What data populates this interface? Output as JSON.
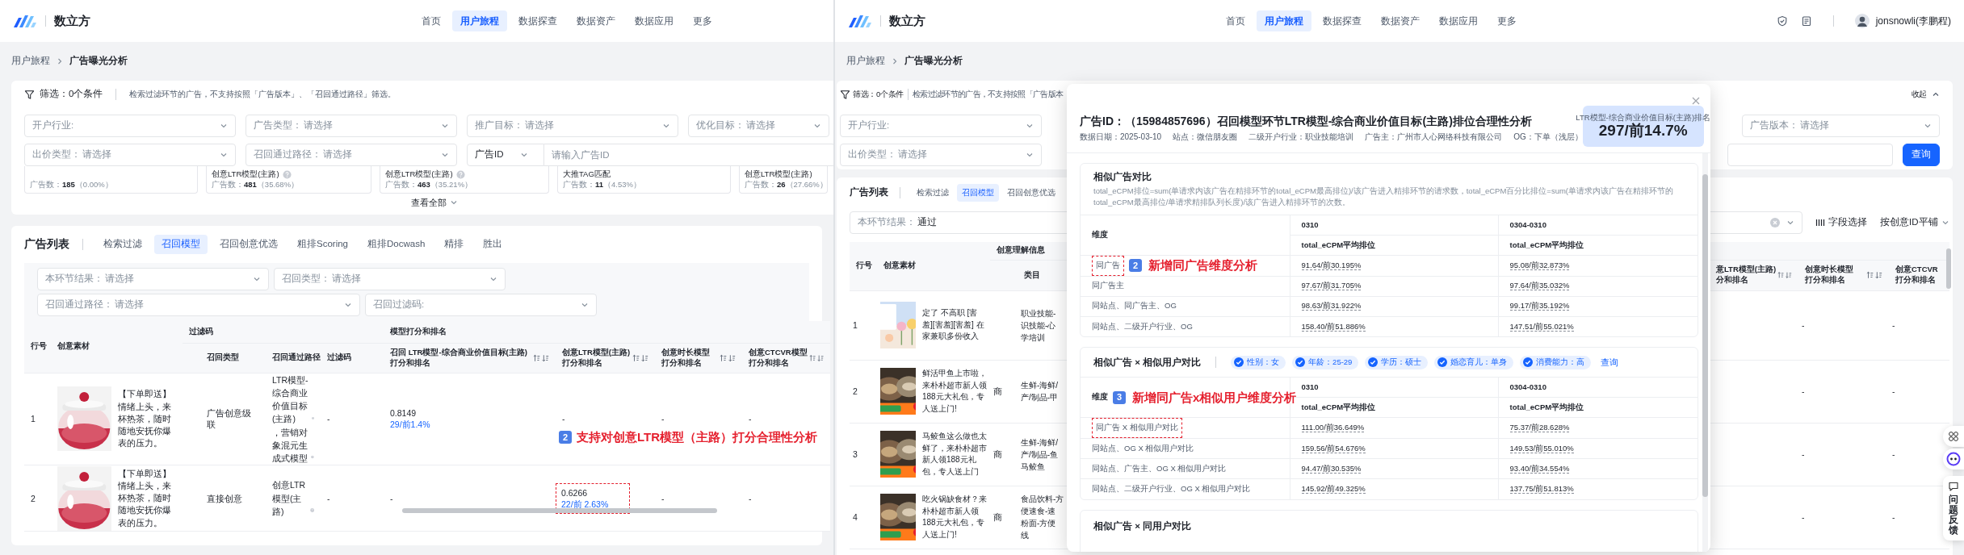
{
  "left_screen": {
    "header": {
      "brand": "数立方",
      "nav": [
        {
          "label": "首页",
          "selected": false
        },
        {
          "label": "用户旅程",
          "selected": true
        },
        {
          "label": "数据探查",
          "selected": false
        },
        {
          "label": "数据资产",
          "selected": false
        },
        {
          "label": "数据应用",
          "selected": false
        },
        {
          "label": "更多",
          "selected": false
        }
      ]
    },
    "breadcrumb": [
      "用户旅程",
      "广告曝光分析"
    ],
    "filter_panel": {
      "summary": "筛选：0个条件",
      "hint": "检索过滤环节的广告，不支持按照「广告版本」、「召回通过路径」筛选。",
      "rows": [
        [
          {
            "kind": "select",
            "label": "开户行业:"
          },
          {
            "kind": "select",
            "label": "广告类型：",
            "placeholder": "请选择"
          },
          {
            "kind": "select",
            "label": "推广目标：",
            "placeholder": "请选择"
          },
          {
            "kind": "select",
            "label": "优化目标：",
            "placeholder": "请选择"
          }
        ],
        [
          {
            "kind": "select",
            "label": "出价类型：",
            "placeholder": "请选择"
          },
          {
            "kind": "select",
            "label": "召回通过路径：",
            "placeholder": "请选择"
          },
          {
            "kind": "id",
            "label": "广告ID",
            "placeholder": "请输入广告ID"
          }
        ]
      ],
      "stats": [
        {
          "text": "广告数：**185**（0.00%）"
        },
        {
          "title": "创意LTR模型(主路)",
          "help": true,
          "text": "广告数：**481**（35.68%）"
        },
        {
          "title": "创意LTR模型(主路)",
          "help": true,
          "text": "广告数：**463**（35.21%）"
        },
        {
          "title": "大推TAG匹配",
          "help": false,
          "text": "广告数：**11**（4.53%）"
        },
        {
          "title": "创意LTR模型(主路)",
          "help": false,
          "text": "广告数：**26**（27.66%）"
        }
      ],
      "expand": "查看全部"
    },
    "list": {
      "title": "广告列表",
      "tabs": [
        {
          "label": "检索过滤",
          "selected": false
        },
        {
          "label": "召回模型",
          "selected": true
        },
        {
          "label": "召回创意优选",
          "selected": false
        },
        {
          "label": "粗排Scoring",
          "selected": false
        },
        {
          "label": "粗排Docwash",
          "selected": false
        },
        {
          "label": "精排",
          "selected": false
        },
        {
          "label": "胜出",
          "selected": false
        }
      ],
      "filters": [
        {
          "kind": "select",
          "label": "本环节结果：",
          "placeholder": "请选择"
        },
        {
          "kind": "select",
          "label": "召回类型：",
          "placeholder": "请选择"
        },
        {
          "kind": "select",
          "label": "召回通过路径：",
          "placeholder": "请选择"
        },
        {
          "kind": "select",
          "label": "召回过滤码:"
        }
      ],
      "table": {
        "header": [
          {
            "label": "行号"
          },
          {
            "label": "创意素材"
          },
          {
            "label": "过滤码",
            "columns": [
              {
                "label": [
                  "召回类型"
                ]
              },
              {
                "label": [
                  "召回通过路径"
                ]
              },
              {
                "label": [
                  "过滤码"
                ]
              }
            ]
          },
          {
            "label": "模型打分和排名",
            "columns": [
              {
                "label": [
                  "召回 LTR模型-综合商业价值目标(主路)",
                  "打分和排名"
                ],
                "sortable": true
              },
              {
                "label": [
                  "创意LTR模型(主路)",
                  "打分和排名"
                ],
                "sortable": true
              },
              {
                "label": [
                  "创意时长模型",
                  "打分和排名"
                ],
                "sortable": true
              },
              {
                "label": [
                  "创意CTCVR模型",
                  "打分和排名"
                ],
                "sortable": true
              }
            ]
          }
        ],
        "rows": [
          {
            "index": "1",
            "creative": {
              "kind": "picture",
              "text": "【下单即送】情绪上头，来杯热茶，随时随地安抚你爆表的压力。"
            },
            "cells": [
              {
                "kind": "text",
                "text": "广告创意级联"
              },
              {
                "kind": "path",
                "parts": [
                  "LTR模型-综合商业价值目标(主路)",
                  "，营销对象混元生成式模型"
                ]
              },
              {
                "kind": "text",
                "text": "-"
              },
              {
                "kind": "score",
                "score": "0.8149",
                "rank": "29/前1.4%",
                "highlighted": false
              },
              {
                "kind": "text",
                "text": "-"
              },
              {
                "kind": "text",
                "text": "-"
              },
              {
                "kind": "text",
                "text": "-"
              }
            ]
          },
          {
            "index": "2",
            "creative": {
              "kind": "picture",
              "text": "【下单即送】情绪上头，来杯热茶，随时随地安抚你爆表的压力。"
            },
            "cells": [
              {
                "kind": "text",
                "text": "直接创意"
              },
              {
                "kind": "path",
                "parts": [
                  "创意LTR模型(主路)"
                ]
              },
              {
                "kind": "text",
                "text": "-"
              },
              {
                "kind": "text",
                "text": "-"
              },
              {
                "kind": "score",
                "score": "0.6266",
                "rank": "22/前 2.63%",
                "highlighted": true
              },
              {
                "kind": "text",
                "text": "-"
              },
              {
                "kind": "text",
                "text": "-"
              }
            ]
          }
        ]
      },
      "annotation": {
        "number": "2",
        "text": "支持对创意LTR模型（主路）打分合理性分析"
      }
    }
  },
  "right_screen": {
    "header": {
      "brand": "数立方",
      "nav": [
        {
          "label": "首页",
          "selected": false
        },
        {
          "label": "用户旅程",
          "selected": true
        },
        {
          "label": "数据探查",
          "selected": false
        },
        {
          "label": "数据资产",
          "selected": false
        },
        {
          "label": "数据应用",
          "selected": false
        },
        {
          "label": "更多",
          "selected": false
        }
      ],
      "user": "jonsnowli(李鹏程)"
    },
    "breadcrumb": [
      "用户旅程",
      "广告曝光分析"
    ],
    "filter_panel": {
      "summary": "筛选：0个条件",
      "hint": "检索过滤环节的广告，不支持按照「广告版本",
      "collapse": "收起",
      "rows": [
        [
          {
            "kind": "select",
            "label": "开户行业:"
          },
          {
            "kind": "select",
            "label": "广告版本：",
            "placeholder": "请选择"
          }
        ],
        [
          {
            "kind": "select",
            "label": "出价类型：",
            "placeholder": "请选择"
          },
          {
            "kind": "input"
          },
          {
            "kind": "button",
            "label": "查询"
          }
        ]
      ]
    },
    "list": {
      "title": "广告列表",
      "tabs": [
        {
          "label": "检索过滤",
          "selected": false
        },
        {
          "label": "召回模型",
          "selected": true
        },
        {
          "label": "召回创意优选",
          "selected": false
        }
      ],
      "filter": {
        "label": "本环节结果：",
        "value": "通过",
        "clearable": true
      },
      "tools": [
        {
          "kind": "columns",
          "label": "字段选择"
        },
        {
          "kind": "dropdown",
          "label": "按创意ID平铺"
        }
      ],
      "table": {
        "index_header": "行号",
        "creative_header": "创意素材",
        "group": "创意理解信息",
        "category_header": "类目",
        "score_columns": [
          {
            "label": [
              "意LTR模型(主路)",
              "分和排名"
            ],
            "sortable": true
          },
          {
            "label": [
              "创意时长模型",
              "打分和排名"
            ],
            "sortable": true
          },
          {
            "label": [
              "创意CTCVR",
              "打分和排名"
            ],
            "sortable": false
          }
        ],
        "rows": [
          {
            "index": "1",
            "creative": {
              "kind": "picture",
              "text": "定了 不高职 [害羞][害羞][害羞] 在家兼职多份收入"
            },
            "category": [
              "职业技能-",
              "识技能-心",
              "学培训"
            ],
            "cells": [
              "-",
              "-"
            ]
          },
          {
            "index": "2",
            "creative": {
              "kind": "picture",
              "text": "鲜活甲鱼上市啦，来朴朴超市新人领188元大礼包，专人送上门!"
            },
            "column_3": "商",
            "category": [
              "生鲜-海鲜/",
              "产/制品-甲"
            ],
            "cells": [
              "-",
              "-"
            ]
          },
          {
            "index": "3",
            "creative": {
              "kind": "picture",
              "text": "马鲛鱼这么做也太鲜了，来朴朴超市新人领188元礼包，专人送上门"
            },
            "column_3": "商",
            "category": [
              "生鲜-海鲜/",
              "产/制品-鱼",
              "马鲛鱼"
            ],
            "cells": [
              "-",
              "-"
            ]
          },
          {
            "index": "4",
            "creative": {
              "kind": "picture",
              "text": "吃火锅缺食材？来朴朴超市新人领188元大礼包，专人送上门!"
            },
            "column_3": "商",
            "category": [
              "食品饮料-方",
              "便速食-速",
              "粉面-方便",
              "线"
            ],
            "cells": [
              "-",
              "-"
            ]
          }
        ]
      }
    },
    "modal": {
      "title": "广告ID：（15984857696）召回模型环节LTR模型-综合商业价值目标(主路)排位合理性分析",
      "meta": [
        "数据日期：2025-03-10",
        "站点：微信朋友圈",
        "二级开户行业：职业技能培训",
        "广告主：广州市人心网络科技有限公司",
        "OG：下单（浅层）"
      ],
      "rank": {
        "label": "LTR模型-综合商业价值目标(主路)排名",
        "value": "297/前14.7%"
      },
      "sections": [
        {
          "kind": "table",
          "title": "相似广告对比",
          "description": "total_eCPM排位=sum(单请求内该广告在精排环节的total_eCPM最高排位)/该广告进入精排环节的请求数，total_eCPM百分比排位=sum(单请求内该广告在精排环节的total_eCPM最高排位/单请求精排队列长度)/该广告进入精排环节的次数。",
          "columns": [
            {
              "label": "维度"
            },
            {
              "label": "0310",
              "metric": "total_eCPM平均排位"
            },
            {
              "label": "0304-0310",
              "metric": "total_eCPM平均排位"
            }
          ],
          "rows": [
            {
              "dimension": "同广告",
              "highlighted": true,
              "annotation": {
                "number": "2",
                "text": "新增同广告维度分析"
              },
              "values": [
                "91.64/前30.195%",
                "95.08/前32.873%"
              ]
            },
            {
              "dimension": "同广告主",
              "highlighted": false,
              "values": [
                "97.67/前31.705%",
                "97.64/前35.032%"
              ]
            },
            {
              "dimension": "同站点、同广告主、OG",
              "highlighted": false,
              "values": [
                "98.63/前31.922%",
                "99.17/前35.192%"
              ]
            },
            {
              "dimension": "同站点、二级开户行业、OG",
              "highlighted": false,
              "values": [
                "158.40/前51.886%",
                "147.51/前55.021%"
              ]
            }
          ]
        },
        {
          "kind": "table",
          "title": "相似广告 × 相似用户对比",
          "chips": [
            {
              "label": "性别：女",
              "checked": true
            },
            {
              "label": "年龄：25-29",
              "checked": true
            },
            {
              "label": "学历：硕士",
              "checked": true
            },
            {
              "label": "婚恋育儿：单身",
              "checked": true
            },
            {
              "label": "消费能力：高",
              "checked": true
            }
          ],
          "action": "查询",
          "columns": [
            {
              "label": "维度",
              "annotation": {
                "number": "3",
                "text": "新增同广告x相似用户维度分析"
              }
            },
            {
              "label": "0310",
              "metric": "total_eCPM平均排位"
            },
            {
              "label": "0304-0310",
              "metric": "total_eCPM平均排位"
            }
          ],
          "rows": [
            {
              "dimension": "同广告 X 相似用户对比",
              "highlighted": true,
              "values": [
                "111.00/前36.649%",
                "75.37/前28.628%"
              ]
            },
            {
              "dimension": "同站点、OG X 相似用户对比",
              "highlighted": false,
              "values": [
                "159.56/前54.676%",
                "149.53/前55.010%"
              ]
            },
            {
              "dimension": "同站点、广告主、OG X 相似用户对比",
              "highlighted": false,
              "values": [
                "94.47/前30.535%",
                "93.40/前34.554%"
              ]
            },
            {
              "dimension": "同站点、二级开户行业、OG X 相似用户对比",
              "highlighted": false,
              "values": [
                "145.92/前49.325%",
                "137.75/前51.813%"
              ]
            }
          ]
        },
        {
          "kind": "title",
          "title": "相似广告 × 同用户对比"
        }
      ]
    },
    "side_tools": {
      "feedback": "问题反馈"
    }
  }
}
